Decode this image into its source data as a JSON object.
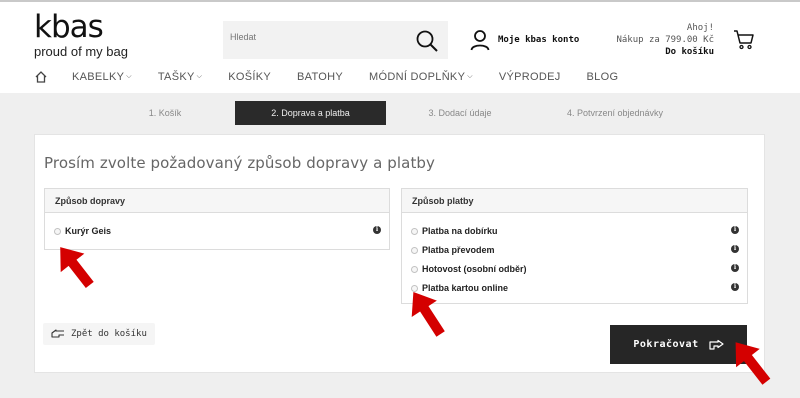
{
  "header": {
    "logo_word": "kbas",
    "logo_tagline": "proud of my bag",
    "search_placeholder": "Hledat",
    "account_label": "Moje kbas konto",
    "cart_greeting": "Ahoj!",
    "cart_total": "Nákup za 799.00 Kč",
    "cart_link": "Do košíku"
  },
  "nav": {
    "items": [
      {
        "label": "KABELKY",
        "caret": true
      },
      {
        "label": "TAŠKY",
        "caret": true
      },
      {
        "label": "KOŠÍKY",
        "caret": false
      },
      {
        "label": "BATOHY",
        "caret": false
      },
      {
        "label": "MÓDNÍ DOPLŇKY",
        "caret": true
      },
      {
        "label": "VÝPRODEJ",
        "caret": false
      },
      {
        "label": "BLOG",
        "caret": false
      }
    ]
  },
  "steps": [
    "1. Košík",
    "2. Doprava a platba",
    "3. Dodací údaje",
    "4. Potvrzení objednávky"
  ],
  "main": {
    "title": "Prosím zvolte požadovaný způsob dopravy a platby",
    "shipping": {
      "heading": "Způsob dopravy",
      "options": [
        "Kurýr Geis"
      ]
    },
    "payment": {
      "heading": "Způsob platby",
      "options": [
        "Platba na dobírku",
        "Platba převodem",
        "Hotovost (osobní odběr)",
        "Platba kartou online"
      ]
    },
    "back_label": "Zpět do košíku",
    "continue_label": "Pokračovat"
  },
  "colors": {
    "accent_dark": "#262626",
    "annotation_arrow": "#d40000",
    "background": "#efefef"
  }
}
